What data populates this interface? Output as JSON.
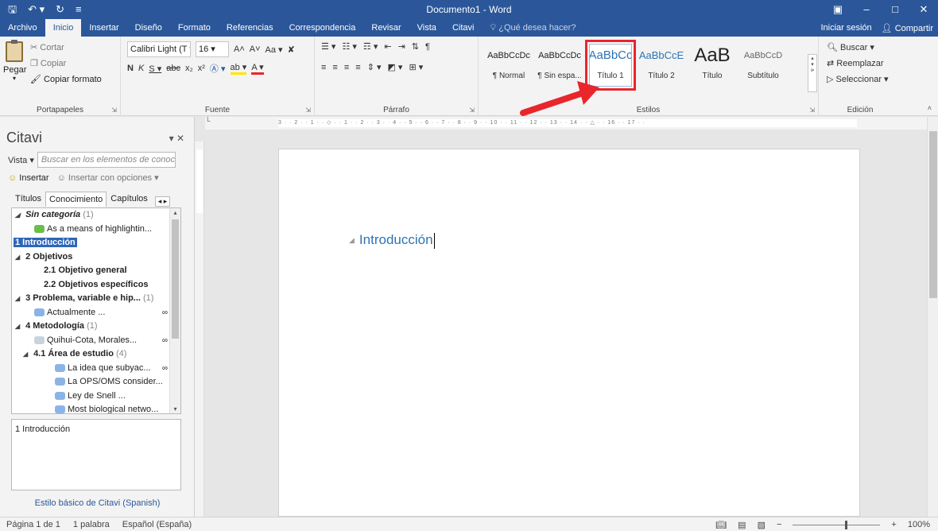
{
  "window": {
    "title": "Documento1 - Word"
  },
  "account": {
    "sign_in": "Iniciar sesión",
    "share": "Compartir"
  },
  "tabs": [
    "Archivo",
    "Inicio",
    "Insertar",
    "Diseño",
    "Formato",
    "Referencias",
    "Correspondencia",
    "Revisar",
    "Vista",
    "Citavi"
  ],
  "tell_me": "¿Qué desea hacer?",
  "clipboard": {
    "paste": "Pegar",
    "cut": "Cortar",
    "copy": "Copiar",
    "format_painter": "Copiar formato",
    "label": "Portapapeles"
  },
  "font": {
    "name": "Calibri Light (T",
    "size": "16",
    "label": "Fuente",
    "case": "Aa"
  },
  "paragraph": {
    "label": "Párrafo"
  },
  "styles": {
    "label": "Estilos",
    "items": [
      {
        "preview": "AaBbCcDc",
        "name": "¶ Normal"
      },
      {
        "preview": "AaBbCcDc",
        "name": "¶ Sin espa..."
      },
      {
        "preview": "AaBbCc",
        "name": "Título 1"
      },
      {
        "preview": "AaBbCcE",
        "name": "Título 2"
      },
      {
        "preview": "AaB",
        "name": "Título"
      },
      {
        "preview": "AaBbCcD",
        "name": "Subtítulo"
      }
    ]
  },
  "editing": {
    "find": "Buscar",
    "replace": "Reemplazar",
    "select": "Seleccionar",
    "label": "Edición"
  },
  "citavi": {
    "title": "Citavi",
    "vista": "Vista",
    "search_placeholder": "Buscar en los elementos de conocimiento",
    "insert": "Insertar",
    "insert_options": "Insertar con opciones",
    "tabs": [
      "Títulos",
      "Conocimiento",
      "Capítulos"
    ],
    "tree": [
      {
        "text": "Sin categoría",
        "count": "(1)"
      },
      {
        "text": "As a means of highlightin..."
      },
      {
        "text": "1 Introducción"
      },
      {
        "text": "2 Objetivos"
      },
      {
        "text": "2.1 Objetivo general"
      },
      {
        "text": "2.2 Objetivos específicos"
      },
      {
        "text": "3 Problema, variable e hip...",
        "count": "(1)"
      },
      {
        "text": "Actualmente ..."
      },
      {
        "text": "4 Metodología",
        "count": "(1)"
      },
      {
        "text": "Quihui-Cota, Morales..."
      },
      {
        "text": "4.1 Área de estudio",
        "count": "(4)"
      },
      {
        "text": "La idea que subyac..."
      },
      {
        "text": "La OPS/OMS consider..."
      },
      {
        "text": "Ley de Snell ..."
      },
      {
        "text": "Most biological netwo..."
      }
    ],
    "detail": "1 Introducción",
    "style_link": "Estilo básico de Citavi (Spanish)"
  },
  "document": {
    "heading": "Introducción"
  },
  "status": {
    "page": "Página 1 de 1",
    "words": "1 palabra",
    "language": "Español (España)",
    "zoom": "100%"
  },
  "colors": {
    "accent": "#2b579a",
    "heading": "#2e74b5",
    "highlight": "#e8262b"
  }
}
